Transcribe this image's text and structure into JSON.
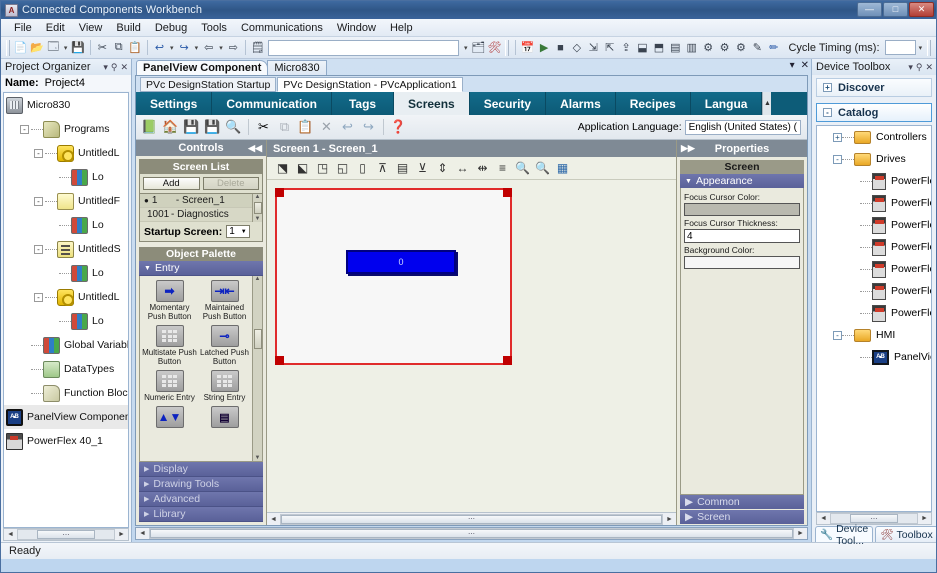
{
  "window": {
    "title": "Connected Components Workbench",
    "icon": "ccw-app-icon",
    "minimize": "—",
    "maximize": "□",
    "close": "✕"
  },
  "menu": [
    "File",
    "Edit",
    "View",
    "Build",
    "Debug",
    "Tools",
    "Communications",
    "Window",
    "Help"
  ],
  "toolbar": {
    "cycle_timing_label": "Cycle Timing (ms):",
    "cycle_timing_value": "",
    "find_combo_value": ""
  },
  "project_organizer": {
    "title": "Project Organizer",
    "autohide_icon": "pin-icon",
    "close_icon": "close-icon",
    "name_label": "Name:",
    "name_value": "Project4",
    "tree": [
      {
        "label": "Micro830",
        "icon": "controller-icon",
        "depth": 0,
        "expander": ""
      },
      {
        "label": "Programs",
        "icon": "programs-icon",
        "depth": 1,
        "expander": "-"
      },
      {
        "label": "UntitledL",
        "icon": "ladder-icon",
        "depth": 2,
        "expander": "-"
      },
      {
        "label": "Lo",
        "icon": "variables-icon",
        "depth": 3,
        "expander": ""
      },
      {
        "label": "UntitledF",
        "icon": "fbd-icon",
        "depth": 2,
        "expander": "-"
      },
      {
        "label": "Lo",
        "icon": "variables-icon",
        "depth": 3,
        "expander": ""
      },
      {
        "label": "UntitledS",
        "icon": "st-icon",
        "depth": 2,
        "expander": "-"
      },
      {
        "label": "Lo",
        "icon": "variables-icon",
        "depth": 3,
        "expander": ""
      },
      {
        "label": "UntitledL",
        "icon": "ladder-icon",
        "depth": 2,
        "expander": "-"
      },
      {
        "label": "Lo",
        "icon": "variables-icon",
        "depth": 3,
        "expander": ""
      },
      {
        "label": "Global Variables",
        "icon": "variables-icon",
        "depth": 1,
        "expander": ""
      },
      {
        "label": "DataTypes",
        "icon": "datatypes-icon",
        "depth": 1,
        "expander": ""
      },
      {
        "label": "Function Blocks",
        "icon": "function-blocks-icon",
        "depth": 1,
        "expander": ""
      },
      {
        "label": "PanelView Component",
        "icon": "panelview-icon",
        "depth": 0,
        "expander": "",
        "selected": true
      },
      {
        "label": "PowerFlex 40_1",
        "icon": "powerflex-icon",
        "depth": 0,
        "expander": ""
      }
    ]
  },
  "document_tabs": [
    {
      "label": "PanelView Component",
      "active": true
    },
    {
      "label": "Micro830",
      "active": false
    }
  ],
  "inner_tabs": [
    {
      "label": "PVc DesignStation Startup",
      "active": false
    },
    {
      "label": "PVc DesignStation - PVcApplication1",
      "active": true
    }
  ],
  "ribbon_tabs": [
    {
      "label": "Settings",
      "active": false
    },
    {
      "label": "Communication",
      "active": false
    },
    {
      "label": "Tags",
      "active": false
    },
    {
      "label": "Screens",
      "active": true
    },
    {
      "label": "Security",
      "active": false
    },
    {
      "label": "Alarms",
      "active": false
    },
    {
      "label": "Recipes",
      "active": false
    },
    {
      "label": "Langua",
      "active": false
    }
  ],
  "ribbon_bar": {
    "buttons": [
      "open-app-icon",
      "home-icon",
      "save-icon",
      "save-as-icon",
      "preview-icon",
      "cut-icon",
      "copy-icon",
      "paste-icon",
      "delete-icon",
      "undo-icon",
      "redo-icon",
      "help-icon"
    ],
    "app_language_label": "Application Language:",
    "app_language_value": "English (United States) ("
  },
  "controls_panel": {
    "title": "Controls",
    "collapse_icon": "collapse-left-icon",
    "screen_list": {
      "title": "Screen List",
      "add_label": "Add",
      "delete_label": "Delete",
      "items": [
        {
          "marker": "●",
          "number": "1",
          "name": "- Screen_1",
          "selected": true
        },
        {
          "marker": "",
          "number": "1001",
          "name": "- Diagnostics",
          "selected": false
        }
      ]
    },
    "startup_screen_label": "Startup Screen:",
    "startup_screen_value": "1",
    "object_palette_title": "Object Palette",
    "groups": [
      {
        "label": "Entry",
        "expanded": true
      },
      {
        "label": "Display",
        "expanded": false
      },
      {
        "label": "Drawing Tools",
        "expanded": false
      },
      {
        "label": "Advanced",
        "expanded": false
      },
      {
        "label": "Library",
        "expanded": false
      }
    ],
    "entry_items": [
      {
        "label": "Momentary Push Button",
        "icon": "momentary-push-button-icon",
        "glyph": "➡"
      },
      {
        "label": "Maintained Push Button",
        "icon": "maintained-push-button-icon",
        "glyph": "⇥⇤"
      },
      {
        "label": "Multistate Push Button",
        "icon": "multistate-push-button-icon",
        "glyph": "keypad"
      },
      {
        "label": "Latched Push Button",
        "icon": "latched-push-button-icon",
        "glyph": "⊸"
      },
      {
        "label": "Numeric Entry",
        "icon": "numeric-entry-icon",
        "glyph": "keypad"
      },
      {
        "label": "String Entry",
        "icon": "string-entry-icon",
        "glyph": "keypad"
      },
      {
        "label": "",
        "icon": "numeric-updown-icon",
        "glyph": "▲▼"
      },
      {
        "label": "",
        "icon": "list-selector-icon",
        "glyph": "list"
      }
    ]
  },
  "canvas": {
    "title": "Screen 1 - Screen_1",
    "tools": [
      "align-left-icon",
      "align-center-icon",
      "align-right-icon",
      "align-group-icon",
      "align-vert-left-icon",
      "align-vert-top-icon",
      "align-vert-center-icon",
      "align-bottom-icon",
      "make-same-height-icon",
      "make-same-width-icon",
      "make-same-size-icon",
      "distribute-icon",
      "zoom-in-icon",
      "zoom-out-icon",
      "grid-icon"
    ],
    "object": {
      "type": "push-button",
      "text": "0",
      "fill_color": "#0000EE",
      "border_color": "#000080"
    },
    "screen_border_color": "#E02B2B",
    "hscroll_grip": "⋯"
  },
  "properties_panel": {
    "title": "Properties",
    "expand_icon": "expand-right-icon",
    "object_label": "Screen",
    "groups": [
      {
        "label": "Appearance",
        "expanded": true
      },
      {
        "label": "Common",
        "expanded": false
      },
      {
        "label": "Screen",
        "expanded": false
      }
    ],
    "fields": [
      {
        "label": "Focus Cursor Color:",
        "value": "",
        "kind": "color"
      },
      {
        "label": "Focus Cursor Thickness:",
        "value": "4",
        "kind": "text"
      },
      {
        "label": "Background Color:",
        "value": "",
        "kind": "white"
      }
    ]
  },
  "device_toolbox": {
    "title": "Device Toolbox",
    "autohide_icon": "pin-icon",
    "close_icon": "close-icon",
    "sections": [
      {
        "label": "Discover",
        "expander": "+",
        "active": false
      },
      {
        "label": "Catalog",
        "expander": "-",
        "active": true
      }
    ],
    "tree": [
      {
        "label": "Controllers",
        "icon": "folder-icon",
        "depth": 1,
        "expander": "+"
      },
      {
        "label": "Drives",
        "icon": "folder-open-icon",
        "depth": 1,
        "expander": "-"
      },
      {
        "label": "PowerFle",
        "icon": "device-icon",
        "depth": 2,
        "expander": ""
      },
      {
        "label": "PowerFle",
        "icon": "device-icon",
        "depth": 2,
        "expander": ""
      },
      {
        "label": "PowerFle",
        "icon": "device-icon",
        "depth": 2,
        "expander": ""
      },
      {
        "label": "PowerFle",
        "icon": "device-icon",
        "depth": 2,
        "expander": ""
      },
      {
        "label": "PowerFle",
        "icon": "device-icon",
        "depth": 2,
        "expander": ""
      },
      {
        "label": "PowerFle",
        "icon": "device-icon",
        "depth": 2,
        "expander": ""
      },
      {
        "label": "PowerFle",
        "icon": "device-icon",
        "depth": 2,
        "expander": ""
      },
      {
        "label": "HMI",
        "icon": "folder-open-icon",
        "depth": 1,
        "expander": "-"
      },
      {
        "label": "PanelVie",
        "icon": "panelview-icon",
        "depth": 2,
        "expander": ""
      }
    ],
    "dock_tabs": [
      {
        "label": "Device Tool...",
        "icon": "wrench-icon",
        "active": true
      },
      {
        "label": "Toolbox",
        "icon": "tools-icon",
        "active": false
      }
    ]
  },
  "statusbar": {
    "text": "Ready"
  }
}
